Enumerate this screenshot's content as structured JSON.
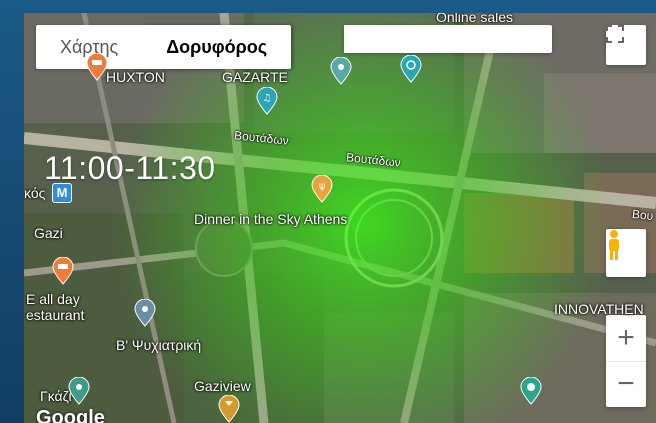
{
  "map_type": {
    "map_label": "Χάρτης",
    "satellite_label": "Δορυφόρος",
    "selected": "satellite"
  },
  "time_range": "11:00-11:30",
  "labels": {
    "dinner": "Dinner in the Sky Athens",
    "gazi": "Gazi",
    "all_day": "E all day",
    "restaurant": "estaurant",
    "psychiatriki": "Β' Ψυχιατρική",
    "gaziview": "Gaziview",
    "innovathens": "INNOVATHEN",
    "gazarte": "GAZARTE",
    "huxton": "HUXTON",
    "online_sales": "Online sales",
    "boutadon_1": "Βουτάδων",
    "boutadon_2": "Βουτάδων",
    "bou_edge": "Βου",
    "kos_edge": "κός",
    "ikazi": "Γκάζι",
    "metro": "M",
    "brand": "Google"
  },
  "controls": {
    "zoom_in": "+",
    "zoom_out": "−"
  },
  "colors": {
    "heat": "#39ff14",
    "frame": "#16476e",
    "pegman": "#f5b400"
  }
}
